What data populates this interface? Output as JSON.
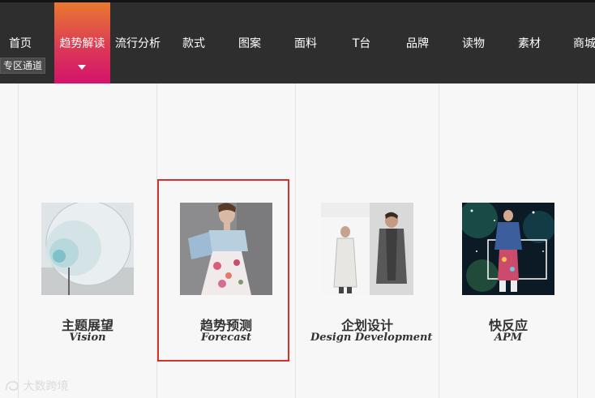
{
  "nav": {
    "items": [
      {
        "label": "首页"
      },
      {
        "label": "趋势解读",
        "active": true
      },
      {
        "label": "流行分析"
      },
      {
        "label": "款式"
      },
      {
        "label": "图案"
      },
      {
        "label": "面料"
      },
      {
        "label": "T台"
      },
      {
        "label": "品牌"
      },
      {
        "label": "读物"
      },
      {
        "label": "素材"
      },
      {
        "label": "商城"
      }
    ],
    "zone_label": "专区通道",
    "active_color_top": "#e9792f",
    "active_color_bottom": "#d4136b"
  },
  "cards": [
    {
      "title_cn": "主题展望",
      "title_en": "Vision",
      "icon": "vision-image"
    },
    {
      "title_cn": "趋势预测",
      "title_en": "Forecast",
      "icon": "forecast-image",
      "highlighted": true
    },
    {
      "title_cn": "企划设计",
      "title_en": "Design Development",
      "icon": "design-development-image"
    },
    {
      "title_cn": "快反应",
      "title_en": "APM",
      "icon": "apm-image"
    }
  ],
  "watermark": {
    "text": "大数跨境"
  },
  "colors": {
    "highlight_border": "#d9302c",
    "topbar": "#2e2e2e"
  }
}
